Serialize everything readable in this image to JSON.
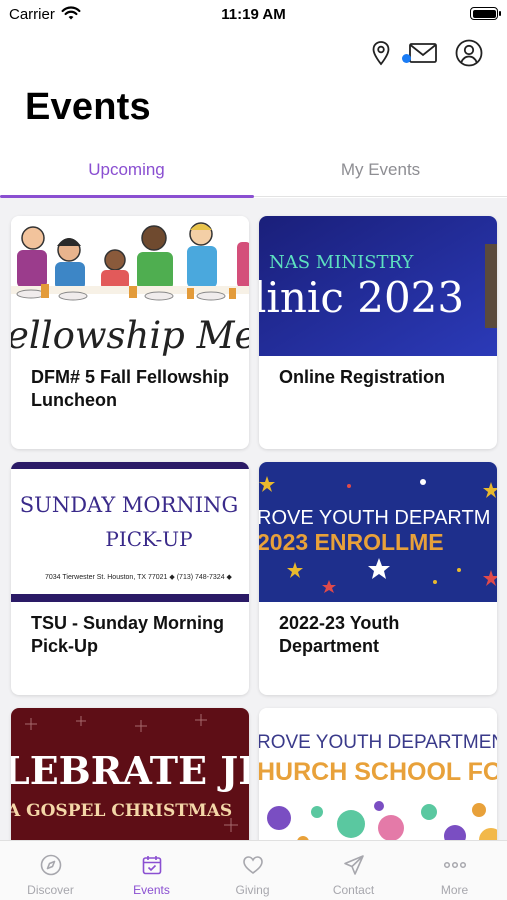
{
  "status_bar": {
    "carrier": "Carrier",
    "time": "11:19 AM"
  },
  "header": {
    "title": "Events",
    "icons": [
      "location-pin-icon",
      "mail-icon",
      "user-profile-icon"
    ],
    "mail_badge_color": "#1a7cf5"
  },
  "tabs": [
    {
      "label": "Upcoming",
      "active": true
    },
    {
      "label": "My Events",
      "active": false
    }
  ],
  "events": [
    {
      "name": "DFM# 5 Fall Fellowship Luncheon",
      "image_text": "ellowship Meal"
    },
    {
      "name": "Online Registration",
      "image_text_top": "NAS MINISTRY",
      "image_text_main": "linic 2023"
    },
    {
      "name": "TSU - Sunday Morning Pick-Up",
      "image_text_top": "SUNDAY MORNING",
      "image_text_main": "PICK-UP",
      "image_text_small": "7034 Tierwester St. Houston, TX 77021 ◆ (713) 748-7324 ◆"
    },
    {
      "name": "2022-23 Youth Department",
      "image_text_top": "ROVE YOUTH DEPARTM",
      "image_text_main": "2023 ENROLLME"
    },
    {
      "name": "",
      "image_text_main": "LEBRATE JESUS",
      "image_text_sub": "A GOSPEL CHRISTMAS"
    },
    {
      "name": "",
      "image_text_top": "ROVE YOUTH DEPARTMEN",
      "image_text_main": "HURCH SCHOOL FO"
    }
  ],
  "tabbar": [
    {
      "label": "Discover",
      "icon": "compass-icon",
      "active": false
    },
    {
      "label": "Events",
      "icon": "calendar-icon",
      "active": true
    },
    {
      "label": "Giving",
      "icon": "heart-icon",
      "active": false
    },
    {
      "label": "Contact",
      "icon": "paper-plane-icon",
      "active": false
    },
    {
      "label": "More",
      "icon": "more-dots-icon",
      "active": false
    }
  ],
  "colors": {
    "accent": "#8a4fd1",
    "inactive": "#a7a7ad",
    "navy": "#1f2a8a"
  }
}
